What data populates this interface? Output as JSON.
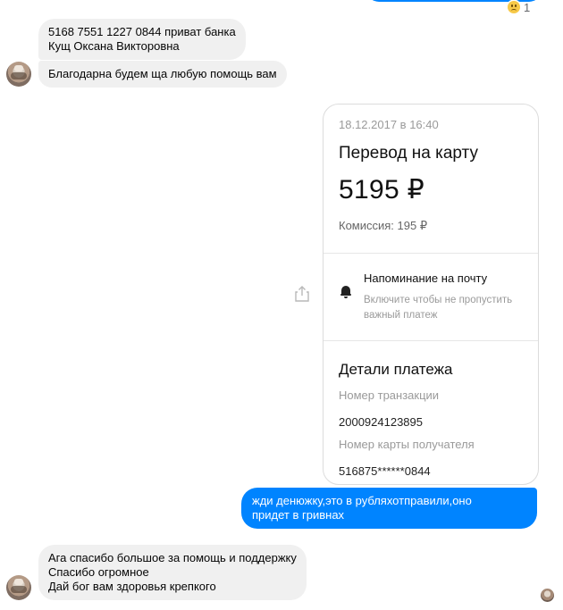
{
  "reaction": {
    "emoji": "crying-face-icon",
    "count": "1"
  },
  "messages_incoming_1": {
    "bubble1_lines": [
      "5168 7551 1227 0844 приват банка",
      "Кущ Оксана Викторовна"
    ],
    "bubble2_lines": [
      "Благодарна будем ща любую помощь вам"
    ]
  },
  "payment_card": {
    "date": "18.12.2017 в 16:40",
    "title": "Перевод на карту",
    "amount": "5195 ₽",
    "fee": "Комиссия: 195 ₽",
    "reminder_title": "Напоминание на почту",
    "reminder_subtitle": "Включите чтобы не пропустить важный платеж",
    "details_title": "Детали платежа",
    "transaction_label": "Номер транзакции",
    "transaction_value": "2000924123895",
    "card_label": "Номер карты получателя",
    "card_value": "516875******0844"
  },
  "message_outgoing": {
    "lines": [
      "жди денюжку,это в рубляхотправили,оно",
      "придет в гривнах"
    ]
  },
  "messages_incoming_2": {
    "lines": [
      "Ага спасибо большое за помощь и поддержку",
      "Спасибо огромное",
      "Дай бог вам здоровья крепкого"
    ]
  },
  "colors": {
    "outgoing": "#0084ff",
    "incoming": "#f0f0f0",
    "text": "#050505",
    "muted": "#9a9a9a"
  }
}
